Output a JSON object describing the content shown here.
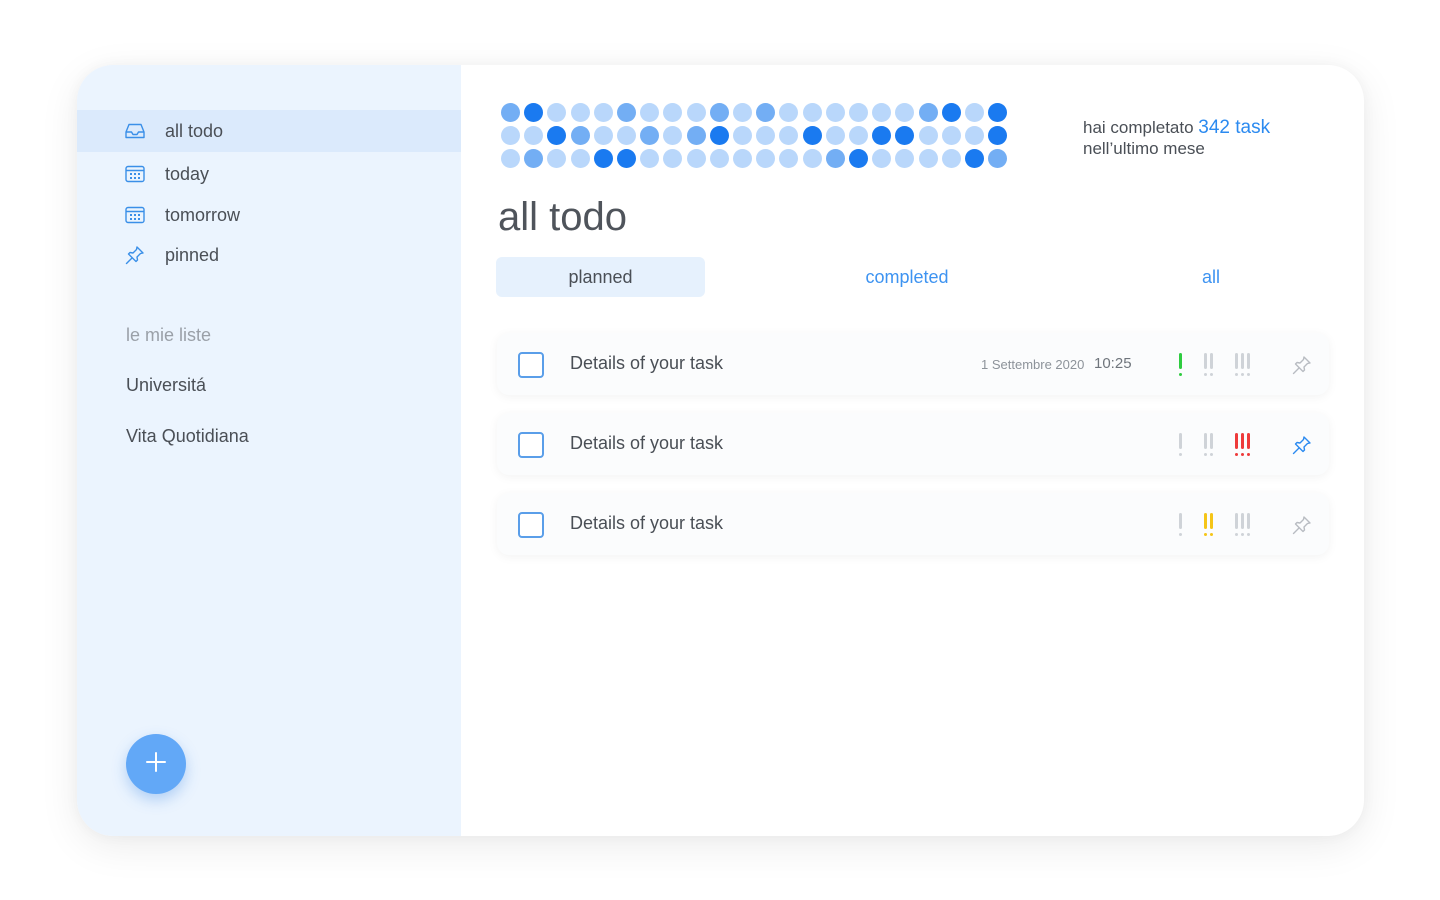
{
  "sidebar": {
    "nav": [
      {
        "label": "all todo",
        "icon": "inbox-icon",
        "active": true
      },
      {
        "label": "today",
        "icon": "calendar-icon",
        "active": false
      },
      {
        "label": "tomorrow",
        "icon": "calendar-icon",
        "active": false
      },
      {
        "label": "pinned",
        "icon": "pin-icon",
        "active": false
      }
    ],
    "lists_title": "le mie liste",
    "lists": [
      "Universitá",
      "Vita Quotidiana"
    ],
    "fab_icon": "plus-icon"
  },
  "activity": {
    "levels": [
      [
        2,
        3,
        1,
        1,
        1,
        2,
        1,
        1,
        1,
        2,
        1,
        2,
        1,
        1,
        1,
        1,
        1,
        1,
        2,
        3,
        1,
        3
      ],
      [
        1,
        1,
        3,
        2,
        1,
        1,
        2,
        1,
        2,
        3,
        1,
        1,
        1,
        3,
        1,
        1,
        3,
        3,
        1,
        1,
        1,
        3
      ],
      [
        1,
        2,
        1,
        1,
        3,
        3,
        1,
        1,
        1,
        1,
        1,
        1,
        1,
        1,
        2,
        3,
        1,
        1,
        1,
        1,
        3,
        2
      ]
    ],
    "colors": [
      "#e8f1fc",
      "#b9d7fb",
      "#73aef4",
      "#1a7af0"
    ]
  },
  "stats": {
    "prefix": "hai completato ",
    "count": "342 task",
    "suffix": "nell’ultimo mese"
  },
  "page_title": "all todo",
  "tabs": [
    {
      "label": "planned",
      "active": true
    },
    {
      "label": "completed",
      "active": false
    },
    {
      "label": "all",
      "active": false
    }
  ],
  "tasks": [
    {
      "text": "Details of your task",
      "date": "1 Settembre 2020",
      "time": "10:25",
      "priority": 1,
      "pinned": false
    },
    {
      "text": "Details of your task",
      "date": "",
      "time": "",
      "priority": 3,
      "pinned": true
    },
    {
      "text": "Details of your task",
      "date": "",
      "time": "",
      "priority": 2,
      "pinned": false
    }
  ],
  "colors": {
    "accent": "#2b8af0",
    "priority_low": "#2ecc40",
    "priority_medium": "#f5c518",
    "priority_high": "#ee3b3b",
    "priority_off": "#cfd3d8",
    "pin_active": "#2b8af0",
    "pin_off": "#b8bcc2"
  }
}
